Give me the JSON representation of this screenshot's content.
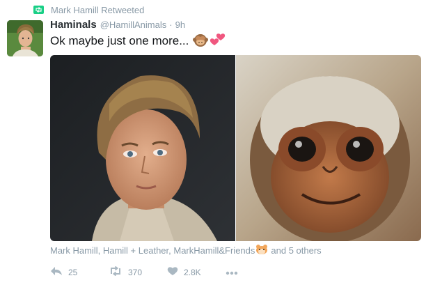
{
  "retweet": {
    "text": "Mark Hamill Retweeted",
    "icon": "retweet-icon"
  },
  "tweet": {
    "display_name": "Haminals",
    "screen_name": "@HamillAnimals",
    "separator": "·",
    "time": "9h",
    "text": "Ok maybe just one more...",
    "emojis": [
      "see-no-evil-monkey-emoji",
      "two-hearts-emoji"
    ]
  },
  "media": {
    "items": [
      {
        "name": "luke-portrait-image"
      },
      {
        "name": "monkey-portrait-image"
      }
    ]
  },
  "likes": {
    "text": "Mark Hamill, Hamill + Leather, MarkHamill&Friends",
    "emoji": "hamster-emoji",
    "others": "and 5 others"
  },
  "actions": {
    "reply": {
      "icon": "reply-icon",
      "count": "25"
    },
    "retweet": {
      "icon": "retweet-icon",
      "count": "370"
    },
    "like": {
      "icon": "heart-icon",
      "count": "2.8K"
    },
    "more": {
      "icon": "more-dots-icon"
    }
  },
  "colors": {
    "retweet_green": "#19cf86",
    "secondary_text": "#8899a6",
    "primary_text": "#14171a"
  }
}
